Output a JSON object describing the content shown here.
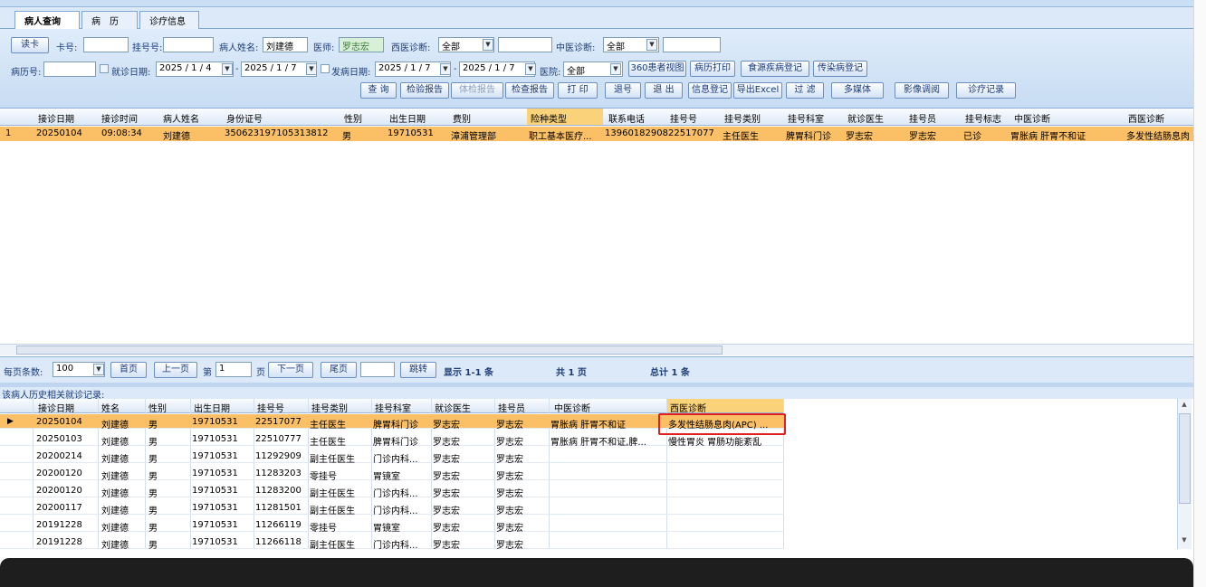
{
  "tabs": [
    {
      "label": "病人查询"
    },
    {
      "label": "病　历"
    },
    {
      "label": "诊疗信息"
    }
  ],
  "filters": {
    "read_card": "读卡",
    "card_no": "卡号:",
    "reg_no": "挂号号:",
    "patient_name_label": "病人姓名:",
    "patient_name": "刘建德",
    "doctor_label": "医师:",
    "doctor": "罗志宏",
    "west_diag_label": "西医诊断:",
    "west_diag": "全部",
    "tcm_diag_label": "中医诊断:",
    "tcm_diag": "全部",
    "record_no": "病历号:",
    "visit_date_label": "就诊日期:",
    "visit_from": "2025 / 1 / 4",
    "visit_to": "2025 / 1 / 7",
    "onset_label": "发病日期:",
    "onset_from": "2025 / 1 / 7",
    "onset_to": "2025 / 1 / 7",
    "hospital_label": "医院:",
    "hospital": "全部"
  },
  "toolbar_row2": [
    "360患者视图",
    "病历打印",
    "食源疾病登记",
    "传染病登记"
  ],
  "toolbar_row3": [
    "查 询",
    "检验报告",
    "体检报告",
    "检查报告",
    "打 印",
    "退号",
    "退 出",
    "信息登记",
    "导出Excel",
    "过 滤",
    "多媒体",
    "影像调阅",
    "诊疗记录"
  ],
  "grid1": {
    "columns": [
      "接诊日期",
      "接诊时间",
      "病人姓名",
      "身份证号",
      "性别",
      "出生日期",
      "费别",
      "险种类型",
      "联系电话",
      "挂号号",
      "挂号类别",
      "挂号科室",
      "就诊医生",
      "挂号员",
      "挂号标志",
      "中医诊断",
      "西医诊断"
    ],
    "rows": [
      [
        "1",
        "20250104",
        "09:08:34",
        "刘建德",
        "350623197105313812",
        "男",
        "19710531",
        "漳浦管理部",
        "职工基本医疗...",
        "13960182908",
        "22517077",
        "主任医生",
        "脾胃科门诊",
        "罗志宏",
        "罗志宏",
        "已诊",
        "胃胀病 肝胃不和证",
        "多发性结肠息肉"
      ]
    ]
  },
  "pager": {
    "page_size_label": "每页条数:",
    "page_size": "100",
    "first": "首页",
    "prev": "上一页",
    "page_label": "第",
    "page": "1",
    "page_unit": "页",
    "next": "下一页",
    "last": "尾页",
    "jump": "跳转",
    "showing": "显示 1-1 条",
    "total_pages": "共 1 页",
    "total": "总计 1 条"
  },
  "history_label": "该病人历史相关就诊记录:",
  "grid2": {
    "columns": [
      "接诊日期",
      "姓名",
      "性别",
      "出生日期",
      "挂号号",
      "挂号类别",
      "挂号科室",
      "就诊医生",
      "挂号员",
      "中医诊断",
      "西医诊断"
    ],
    "rows": [
      [
        "20250104",
        "刘建德",
        "男",
        "19710531",
        "22517077",
        "主任医生",
        "脾胃科门诊",
        "罗志宏",
        "罗志宏",
        "胃胀病 肝胃不和证",
        "多发性结肠息肉(APC) ..."
      ],
      [
        "20250103",
        "刘建德",
        "男",
        "19710531",
        "22510777",
        "主任医生",
        "脾胃科门诊",
        "罗志宏",
        "罗志宏",
        "胃胀病 肝胃不和证,脾...",
        "慢性胃炎 胃肠功能紊乱"
      ],
      [
        "20200214",
        "刘建德",
        "男",
        "19710531",
        "11292909",
        "副主任医生",
        "门诊内科...",
        "罗志宏",
        "罗志宏",
        "",
        ""
      ],
      [
        "20200120",
        "刘建德",
        "男",
        "19710531",
        "11283203",
        "零挂号",
        "胃镜室",
        "罗志宏",
        "罗志宏",
        "",
        ""
      ],
      [
        "20200120",
        "刘建德",
        "男",
        "19710531",
        "11283200",
        "副主任医生",
        "门诊内科...",
        "罗志宏",
        "罗志宏",
        "",
        ""
      ],
      [
        "20200117",
        "刘建德",
        "男",
        "19710531",
        "11281501",
        "副主任医生",
        "门诊内科...",
        "罗志宏",
        "罗志宏",
        "",
        ""
      ],
      [
        "20191228",
        "刘建德",
        "男",
        "19710531",
        "11266119",
        "零挂号",
        "胃镜室",
        "罗志宏",
        "罗志宏",
        "",
        ""
      ],
      [
        "20191228",
        "刘建德",
        "男",
        "19710531",
        "11266118",
        "副主任医生",
        "门诊内科...",
        "罗志宏",
        "罗志宏",
        "",
        ""
      ]
    ]
  },
  "colors": {
    "selected_row": "#fbc066",
    "highlight_box": "#e02020",
    "accent": "#7ea6d3"
  }
}
